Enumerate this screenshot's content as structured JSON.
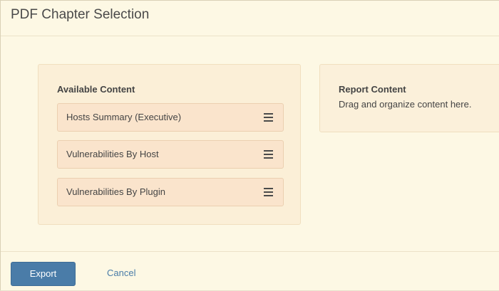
{
  "dialog": {
    "title": "PDF Chapter Selection"
  },
  "available": {
    "heading": "Available Content",
    "items": [
      {
        "label": "Hosts Summary (Executive)",
        "icon": "drag-handle-icon"
      },
      {
        "label": "Vulnerabilities By Host",
        "icon": "drag-handle-icon"
      },
      {
        "label": "Vulnerabilities By Plugin",
        "icon": "drag-handle-icon"
      }
    ]
  },
  "report": {
    "heading": "Report Content",
    "hint": "Drag and organize content here."
  },
  "footer": {
    "export_label": "Export",
    "cancel_label": "Cancel"
  },
  "colors": {
    "background": "#fdf8e4",
    "panel": "#fbefd7",
    "item": "#fae4cc",
    "primary_button": "#4a7ca8",
    "link": "#4a7ca8"
  }
}
